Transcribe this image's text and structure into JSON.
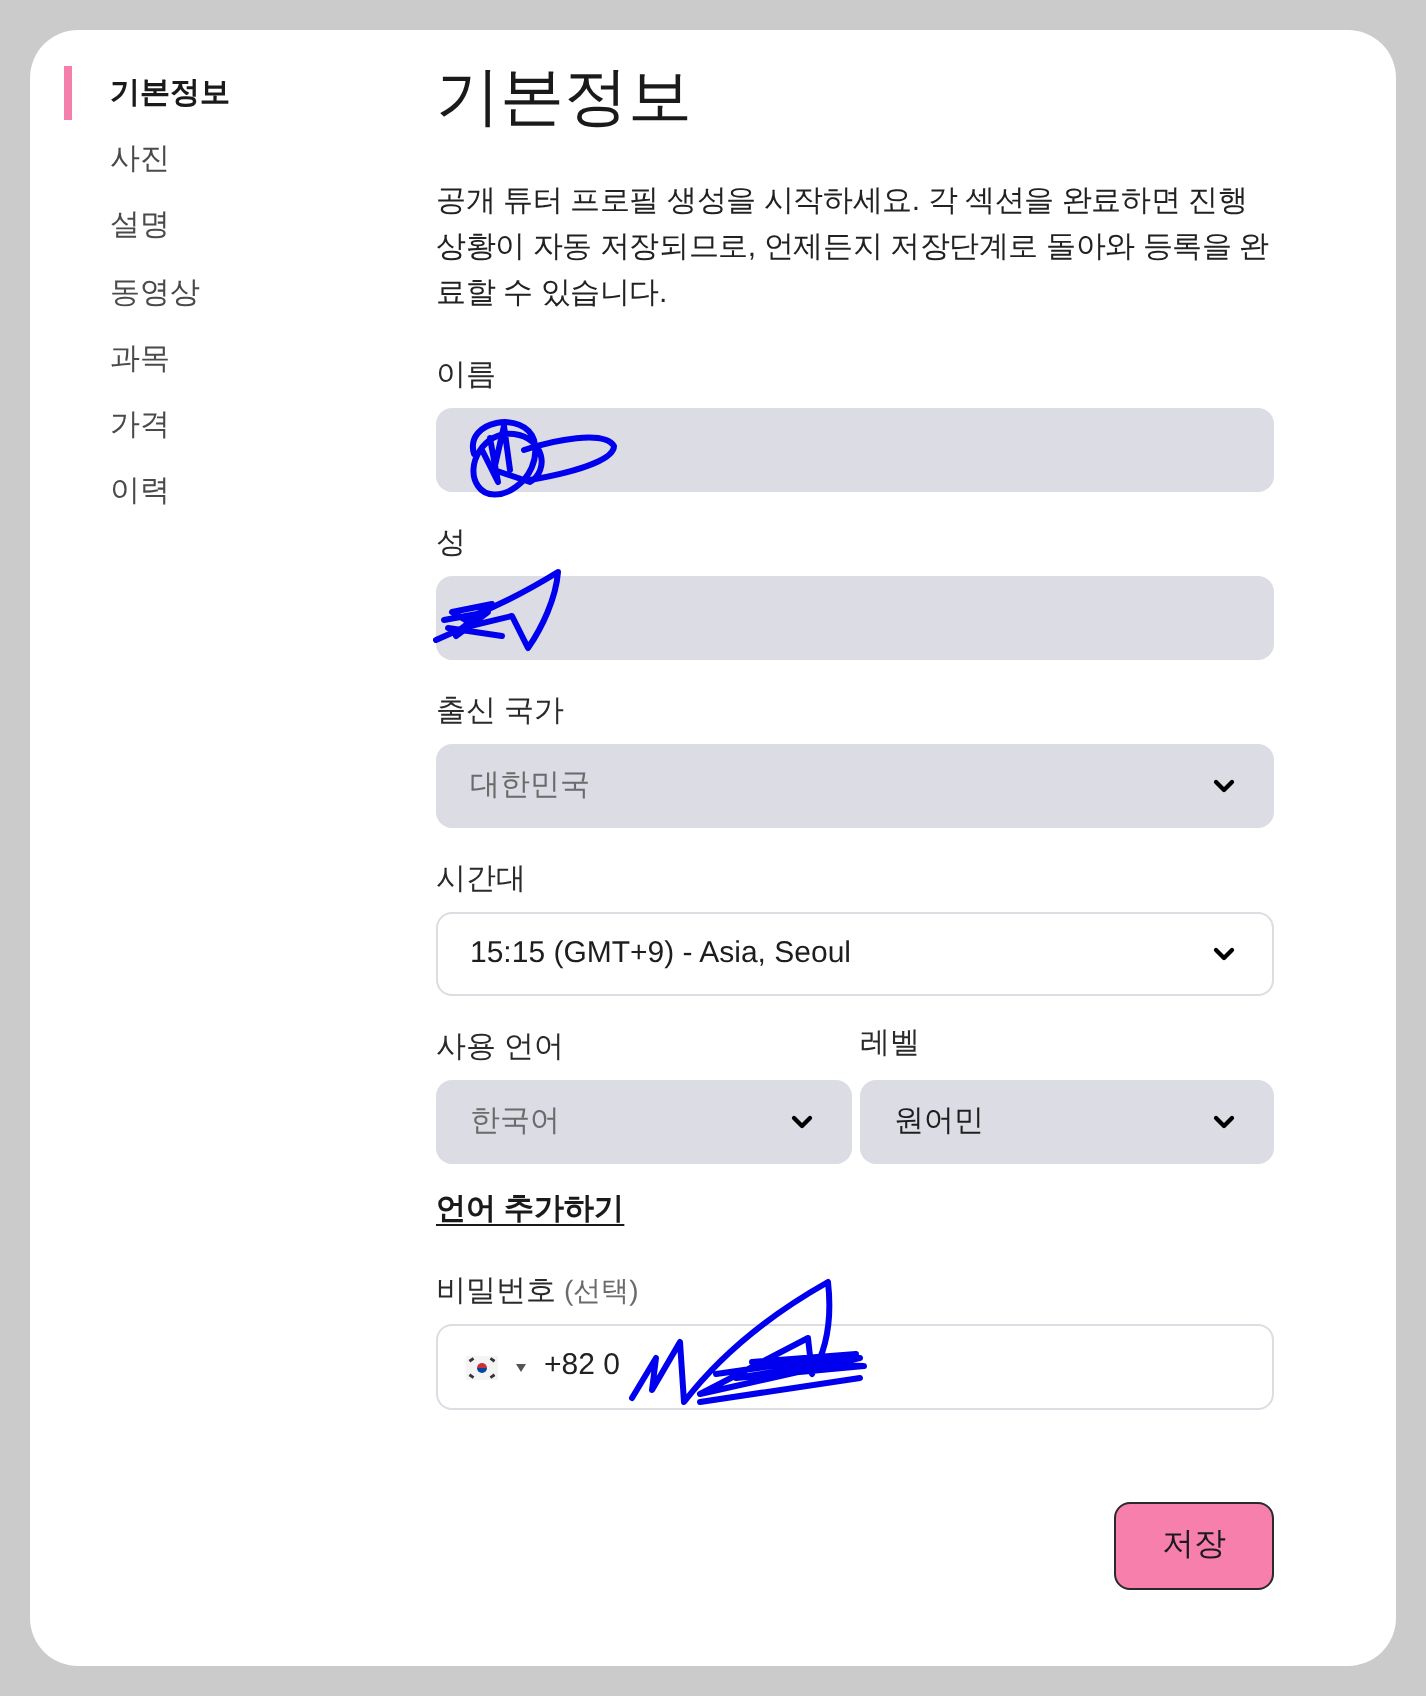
{
  "sidebar": {
    "items": [
      {
        "label": "기본정보",
        "selected": true
      },
      {
        "label": "사진",
        "selected": false
      },
      {
        "label": "설명",
        "selected": false
      },
      {
        "label": "동영상",
        "selected": false
      },
      {
        "label": "과목",
        "selected": false
      },
      {
        "label": "가격",
        "selected": false
      },
      {
        "label": "이력",
        "selected": false
      }
    ]
  },
  "title": "기본정보",
  "description": "공개 튜터 프로필 생성을 시작하세요. 각 섹션을 완료하면 진행 상황이 자동 저장되므로, 언제든지 저장단계로 돌아와 등록을 완료할 수 있습니다.",
  "fields": [
    {
      "kind": "text",
      "label": "이름",
      "filled": true,
      "scribble": true
    },
    {
      "kind": "text",
      "label": "성",
      "filled": true,
      "scribble": true
    },
    {
      "kind": "select",
      "label": "출신 국가",
      "value": "대한민국",
      "filled": true,
      "disabled": true
    },
    {
      "kind": "select",
      "label": "시간대",
      "value": "15:15 (GMT+9) - Asia, Seoul",
      "filled": false,
      "disabled": false
    },
    {
      "kind": "pair",
      "items": [
        {
          "label": "사용 언어",
          "value": "한국어",
          "filled": true,
          "disabled": true
        },
        {
          "label": "레벨",
          "value": "원어민",
          "filled": true,
          "disabled": false
        }
      ]
    },
    {
      "kind": "link",
      "label": "언어 추가하기"
    },
    {
      "kind": "phone",
      "label": "비밀번호",
      "hint": "(선택)",
      "value": "+82 0",
      "filled": false,
      "scribble": true
    }
  ],
  "save_button": "저장"
}
